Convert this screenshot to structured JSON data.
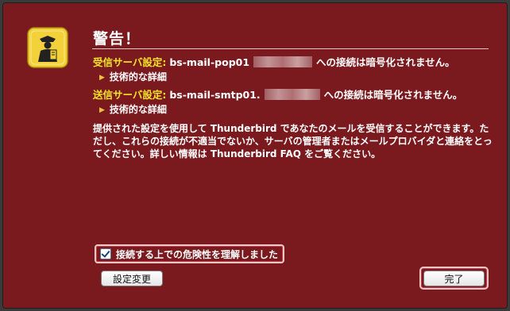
{
  "dialog": {
    "title": "警告！",
    "incoming": {
      "label": "受信サーバ設定:",
      "host": "bs-mail-pop01",
      "suffix": "への接続は暗号化されません。",
      "details": "技術的な詳細"
    },
    "outgoing": {
      "label": "送信サーバ設定:",
      "host": "bs-mail-smtp01.",
      "suffix": "への接続は暗号化されません。",
      "details": "技術的な詳細"
    },
    "paragraph": "提供された設定を使用して Thunderbird であなたのメールを受信することができます。ただし、これらの接続が不適当でないか、サーバの管理者またはメールプロバイダと連絡をとってください。詳しい情報は Thunderbird FAQ をご覧ください。",
    "checkbox": {
      "label": "接続する上での危険性を理解しました",
      "checked": true
    },
    "buttons": {
      "settings": "設定変更",
      "done": "完了"
    }
  },
  "colors": {
    "background": "#7a1a1e",
    "label_accent": "#f7e32a",
    "icon": "#f3d13a"
  },
  "icons": {
    "warning": "warning-officer-icon",
    "disclosure": "disclosure-triangle-icon"
  }
}
